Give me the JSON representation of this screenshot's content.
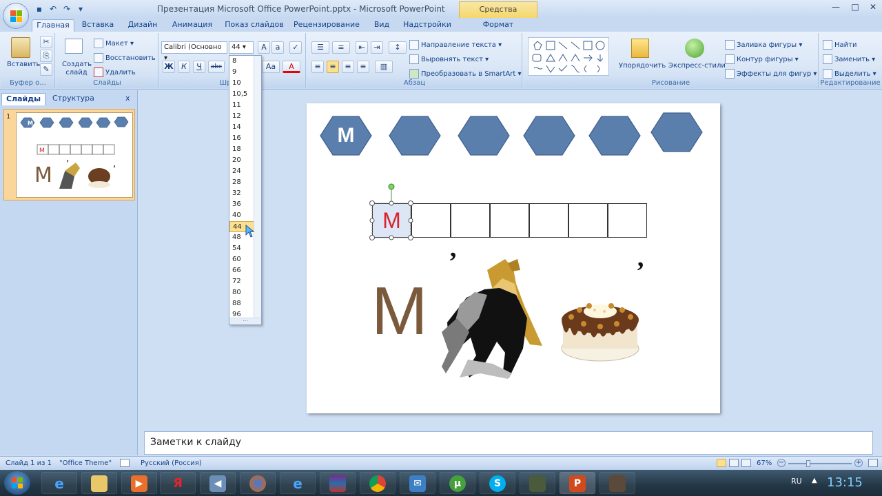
{
  "window": {
    "title": "Презентация Microsoft Office PowerPoint.pptx - Microsoft PowerPoint",
    "context_tab_header": "Средства рисования",
    "controls": [
      "—",
      "□",
      "✕"
    ]
  },
  "tabs": [
    "Главная",
    "Вставка",
    "Дизайн",
    "Анимация",
    "Показ слайдов",
    "Рецензирование",
    "Вид",
    "Надстройки",
    "Формат"
  ],
  "ribbon": {
    "clipboard": {
      "label": "Буфер о...",
      "paste": "Вставить"
    },
    "slides": {
      "label": "Слайды",
      "new_slide": "Создать слайд",
      "layout": "Макет",
      "reset": "Восстановить",
      "delete": "Удалить"
    },
    "font": {
      "label": "Шрифт",
      "font_name": "Calibri (Основно",
      "font_size": "44",
      "bold": "Ж",
      "italic": "К",
      "underline": "Ч",
      "strike": "abc",
      "case": "Aa",
      "color": "A"
    },
    "paragraph": {
      "label": "Абзац",
      "text_direction": "Направление текста",
      "align_text": "Выровнять текст",
      "smartart": "Преобразовать в SmartArt"
    },
    "drawing": {
      "label": "Рисование",
      "arrange": "Упорядочить",
      "quick_styles": "Экспресс-стили",
      "fill": "Заливка фигуры",
      "outline": "Контур фигуры",
      "effects": "Эффекты для фигур"
    },
    "editing": {
      "label": "Редактирование",
      "find": "Найти",
      "replace": "Заменить",
      "select": "Выделить"
    }
  },
  "size_dropdown": {
    "options": [
      "8",
      "9",
      "10",
      "10,5",
      "11",
      "12",
      "14",
      "16",
      "18",
      "20",
      "24",
      "28",
      "32",
      "36",
      "40",
      "44",
      "48",
      "54",
      "60",
      "66",
      "72",
      "80",
      "88",
      "96"
    ],
    "selected": "44"
  },
  "left_pane": {
    "tabs": [
      "Слайды",
      "Структура"
    ],
    "close": "x",
    "slide_number": "1"
  },
  "slide": {
    "hexagons": [
      "М",
      "",
      "",
      "",
      "",
      ""
    ],
    "cells": [
      "М",
      "",
      "",
      "",
      "",
      "",
      ""
    ],
    "big_letter": "М",
    "apostrophe1": "’",
    "apostrophe2": "’",
    "hex_color": "#5b7fad",
    "letter_color": "#7a5a3a",
    "cell_letter_color": "#d9232f"
  },
  "notes": {
    "placeholder": "Заметки к слайду"
  },
  "status": {
    "slide": "Слайд 1 из 1",
    "theme": "\"Office Theme\"",
    "language": "Русский (Россия)",
    "zoom": "67%"
  },
  "taskbar": {
    "lang": "RU",
    "time": "13:15"
  }
}
